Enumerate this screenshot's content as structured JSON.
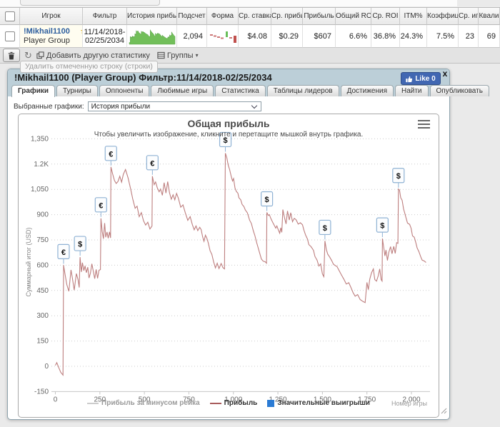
{
  "table": {
    "columns": [
      "",
      "Игрок",
      "Фильтр",
      "История прибы",
      "Подсчет",
      "Форма",
      "Ср. ставка",
      "Ср. прибы.",
      "Прибыль",
      "Общий ROI",
      "Ср. ROI",
      "ITM%",
      "Коэффици",
      "Ср. иг",
      "Квали"
    ],
    "row": {
      "player": "!Mikhail1100",
      "badge": "★",
      "group": "Player Group",
      "filter_line1": "11/14/2018-",
      "filter_line2": "02/25/2034",
      "count": "2,094",
      "avg_stake": "$4.08",
      "avg_profit": "$0.29",
      "profit": "$607",
      "total_roi": "6.6%",
      "avg_roi": "36.8%",
      "itm": "24.3%",
      "coef": "7.5%",
      "avg_games": "23",
      "qualify": "69"
    }
  },
  "toolbar": {
    "refresh_icon": "↻",
    "add_stat_label": "Добавить другую статистику",
    "groups_label": "Группы",
    "groups_caret": "▾"
  },
  "tooltip": "Удалить отмеченную строку (строки)",
  "panel": {
    "title": "!Mikhail1100 (Player Group) Фильтр:11/14/2018-02/25/2034",
    "like_label": "Like 0",
    "close_label": "x",
    "tabs": [
      "Графики",
      "Турниры",
      "Оппоненты",
      "Любимые игры",
      "Статистика",
      "Таблицы лидеров",
      "Достижения",
      "Найти",
      "Опубликовать"
    ],
    "active_tab": "Графики",
    "selector_label": "Выбранные графики:",
    "selector_value": "История прибыли"
  },
  "colors": {
    "profit_line": "#bd7e7e",
    "marker_border": "#8fb2d4",
    "marker_fill": "#fcfdfe",
    "legend_blue": "#2b7bd4",
    "legend_gray": "#cccccc",
    "grid": "#cccccc",
    "sparkline_green": "#72bf5a",
    "like_blue": "#4167b2"
  },
  "chart_data": {
    "type": "line",
    "title": "Общая прибыль",
    "subtitle": "Чтобы увеличить изображение, кликните и перетащите мышкой внутрь графика.",
    "xlabel": "Номер игры",
    "ylabel": "Суммарный итог (USD)",
    "xlim": [
      0,
      2100
    ],
    "ylim": [
      -150,
      1350
    ],
    "grid": "horizontal-dotted",
    "legend_position": "bottom",
    "x_ticks": [
      0,
      250,
      500,
      750,
      1000,
      1250,
      1500,
      1750,
      2000
    ],
    "x_tick_labels": [
      "0",
      "250",
      "500",
      "750",
      "1,000",
      "1,250",
      "1,500",
      "1,750",
      "2,000"
    ],
    "y_ticks": [
      -150,
      0,
      150,
      300,
      450,
      600,
      750,
      900,
      1050,
      1200,
      1350
    ],
    "y_tick_labels": [
      "-150",
      "0",
      "150",
      "300",
      "450",
      "600",
      "750",
      "900",
      "1,050",
      "1.2K",
      "1,350"
    ],
    "legend": [
      {
        "label": "Прибыль за минусом рейка",
        "swatch": "line",
        "color": "#cccccc",
        "text_color": "#9a9a9a"
      },
      {
        "label": "Прибыль",
        "swatch": "line",
        "color": "#a85c5c",
        "text_color": "#333333"
      },
      {
        "label": "Значительные выигрыши",
        "swatch": "square",
        "color": "#2b7bd4",
        "text_color": "#333333"
      }
    ],
    "markers": [
      {
        "game": 46,
        "value": 600,
        "symbol": "€"
      },
      {
        "game": 139,
        "value": 648,
        "symbol": "$"
      },
      {
        "game": 256,
        "value": 878,
        "symbol": "€"
      },
      {
        "game": 312,
        "value": 1183,
        "symbol": "€"
      },
      {
        "game": 545,
        "value": 1128,
        "symbol": "€"
      },
      {
        "game": 955,
        "value": 1265,
        "symbol": "$"
      },
      {
        "game": 1188,
        "value": 913,
        "symbol": "$"
      },
      {
        "game": 1514,
        "value": 744,
        "symbol": "$"
      },
      {
        "game": 1837,
        "value": 758,
        "symbol": "$"
      },
      {
        "game": 1927,
        "value": 1052,
        "symbol": "$"
      }
    ],
    "series": [
      [
        0,
        5
      ],
      [
        8,
        22
      ],
      [
        18,
        -5
      ],
      [
        30,
        -35
      ],
      [
        43,
        -52
      ],
      [
        46,
        600
      ],
      [
        54,
        548
      ],
      [
        64,
        485
      ],
      [
        76,
        445
      ],
      [
        88,
        572
      ],
      [
        96,
        522
      ],
      [
        106,
        452
      ],
      [
        118,
        550
      ],
      [
        127,
        516
      ],
      [
        134,
        468
      ],
      [
        139,
        648
      ],
      [
        146,
        560
      ],
      [
        152,
        615
      ],
      [
        160,
        568
      ],
      [
        167,
        596
      ],
      [
        174,
        556
      ],
      [
        182,
        588
      ],
      [
        189,
        524
      ],
      [
        197,
        553
      ],
      [
        205,
        608
      ],
      [
        213,
        565
      ],
      [
        221,
        520
      ],
      [
        229,
        575
      ],
      [
        237,
        522
      ],
      [
        245,
        570
      ],
      [
        253,
        574
      ],
      [
        256,
        878
      ],
      [
        263,
        800
      ],
      [
        270,
        757
      ],
      [
        277,
        850
      ],
      [
        283,
        766
      ],
      [
        290,
        797
      ],
      [
        297,
        760
      ],
      [
        304,
        798
      ],
      [
        310,
        762
      ],
      [
        312,
        1183
      ],
      [
        322,
        1140
      ],
      [
        332,
        1102
      ],
      [
        342,
        1085
      ],
      [
        352,
        1097
      ],
      [
        362,
        1128
      ],
      [
        372,
        1093
      ],
      [
        382,
        1140
      ],
      [
        394,
        1168
      ],
      [
        408,
        1120
      ],
      [
        422,
        1056
      ],
      [
        435,
        992
      ],
      [
        448,
        938
      ],
      [
        459,
        950
      ],
      [
        471,
        888
      ],
      [
        483,
        912
      ],
      [
        495,
        864
      ],
      [
        507,
        838
      ],
      [
        519,
        855
      ],
      [
        531,
        815
      ],
      [
        543,
        832
      ],
      [
        545,
        1128
      ],
      [
        555,
        1078
      ],
      [
        563,
        1094
      ],
      [
        573,
        1058
      ],
      [
        583,
        1036
      ],
      [
        591,
        1052
      ],
      [
        601,
        1015
      ],
      [
        611,
        1090
      ],
      [
        621,
        1028
      ],
      [
        631,
        1096
      ],
      [
        641,
        1030
      ],
      [
        651,
        992
      ],
      [
        661,
        1018
      ],
      [
        671,
        988
      ],
      [
        681,
        1026
      ],
      [
        691,
        998
      ],
      [
        704,
        944
      ],
      [
        717,
        958
      ],
      [
        729,
        914
      ],
      [
        744,
        866
      ],
      [
        757,
        888
      ],
      [
        769,
        842
      ],
      [
        780,
        810
      ],
      [
        790,
        833
      ],
      [
        800,
        805
      ],
      [
        811,
        825
      ],
      [
        819,
        812
      ],
      [
        827,
        770
      ],
      [
        835,
        742
      ],
      [
        843,
        778
      ],
      [
        851,
        760
      ],
      [
        859,
        732
      ],
      [
        869,
        686
      ],
      [
        879,
        664
      ],
      [
        889,
        620
      ],
      [
        899,
        584
      ],
      [
        909,
        612
      ],
      [
        919,
        580
      ],
      [
        931,
        610
      ],
      [
        941,
        586
      ],
      [
        950,
        578
      ],
      [
        955,
        1265
      ],
      [
        963,
        1238
      ],
      [
        971,
        1194
      ],
      [
        979,
        1167
      ],
      [
        987,
        1131
      ],
      [
        995,
        1100
      ],
      [
        1001,
        1114
      ],
      [
        1009,
        1058
      ],
      [
        1017,
        1037
      ],
      [
        1025,
        1028
      ],
      [
        1031,
        1000
      ],
      [
        1041,
        988
      ],
      [
        1049,
        960
      ],
      [
        1059,
        948
      ],
      [
        1067,
        928
      ],
      [
        1079,
        910
      ],
      [
        1091,
        868
      ],
      [
        1101,
        848
      ],
      [
        1111,
        808
      ],
      [
        1121,
        775
      ],
      [
        1131,
        733
      ],
      [
        1144,
        686
      ],
      [
        1157,
        637
      ],
      [
        1167,
        624
      ],
      [
        1179,
        620
      ],
      [
        1186,
        612
      ],
      [
        1188,
        913
      ],
      [
        1196,
        895
      ],
      [
        1202,
        900
      ],
      [
        1210,
        878
      ],
      [
        1220,
        856
      ],
      [
        1230,
        836
      ],
      [
        1238,
        820
      ],
      [
        1244,
        833
      ],
      [
        1252,
        810
      ],
      [
        1260,
        790
      ],
      [
        1266,
        822
      ],
      [
        1272,
        795
      ],
      [
        1278,
        930
      ],
      [
        1288,
        878
      ],
      [
        1296,
        845
      ],
      [
        1304,
        922
      ],
      [
        1314,
        868
      ],
      [
        1322,
        912
      ],
      [
        1332,
        858
      ],
      [
        1342,
        878
      ],
      [
        1352,
        870
      ],
      [
        1364,
        844
      ],
      [
        1376,
        852
      ],
      [
        1388,
        840
      ],
      [
        1396,
        808
      ],
      [
        1406,
        778
      ],
      [
        1416,
        756
      ],
      [
        1424,
        722
      ],
      [
        1436,
        710
      ],
      [
        1450,
        688
      ],
      [
        1458,
        652
      ],
      [
        1470,
        630
      ],
      [
        1480,
        595
      ],
      [
        1490,
        608
      ],
      [
        1500,
        548
      ],
      [
        1508,
        532
      ],
      [
        1514,
        744
      ],
      [
        1522,
        692
      ],
      [
        1530,
        665
      ],
      [
        1540,
        650
      ],
      [
        1552,
        628
      ],
      [
        1562,
        606
      ],
      [
        1572,
        598
      ],
      [
        1582,
        592
      ],
      [
        1594,
        568
      ],
      [
        1606,
        544
      ],
      [
        1620,
        518
      ],
      [
        1634,
        488
      ],
      [
        1648,
        496
      ],
      [
        1660,
        468
      ],
      [
        1672,
        438
      ],
      [
        1684,
        416
      ],
      [
        1698,
        426
      ],
      [
        1712,
        396
      ],
      [
        1726,
        386
      ],
      [
        1740,
        378
      ],
      [
        1750,
        498
      ],
      [
        1758,
        455
      ],
      [
        1766,
        518
      ],
      [
        1776,
        556
      ],
      [
        1786,
        578
      ],
      [
        1794,
        515
      ],
      [
        1804,
        505
      ],
      [
        1814,
        538
      ],
      [
        1822,
        578
      ],
      [
        1830,
        515
      ],
      [
        1835,
        506
      ],
      [
        1837,
        758
      ],
      [
        1845,
        700
      ],
      [
        1851,
        655
      ],
      [
        1857,
        690
      ],
      [
        1865,
        628
      ],
      [
        1873,
        676
      ],
      [
        1883,
        710
      ],
      [
        1891,
        668
      ],
      [
        1901,
        712
      ],
      [
        1909,
        670
      ],
      [
        1917,
        734
      ],
      [
        1924,
        730
      ],
      [
        1927,
        1052
      ],
      [
        1933,
        1046
      ],
      [
        1940,
        1000
      ],
      [
        1948,
        985
      ],
      [
        1956,
        934
      ],
      [
        1964,
        904
      ],
      [
        1970,
        880
      ],
      [
        1978,
        850
      ],
      [
        1990,
        842
      ],
      [
        1998,
        820
      ],
      [
        2006,
        774
      ],
      [
        2016,
        766
      ],
      [
        2024,
        736
      ],
      [
        2032,
        702
      ],
      [
        2042,
        680
      ],
      [
        2052,
        650
      ],
      [
        2060,
        630
      ],
      [
        2072,
        625
      ],
      [
        2082,
        616
      ]
    ]
  }
}
